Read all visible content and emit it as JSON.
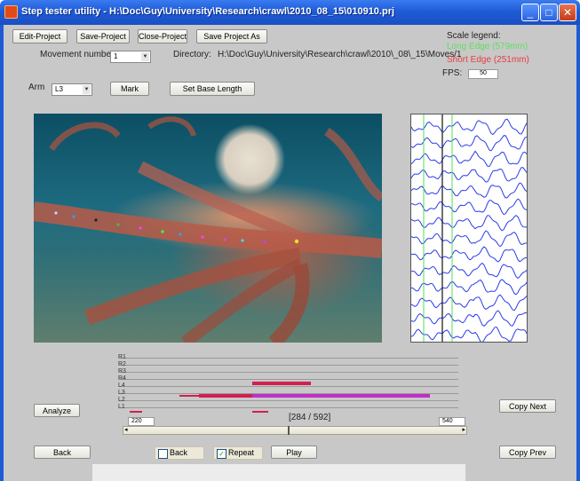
{
  "window": {
    "title": "Step tester utility - H:\\Doc\\Guy\\University\\Research\\crawl\\2010_08_15\\010910.prj",
    "controls": {
      "minimize": "_",
      "maximize": "□",
      "close": "✕"
    }
  },
  "toolbar": {
    "edit_project": "Edit-Project",
    "save_project": "Save-Project",
    "close_project": "Close-Project",
    "save_project_as": "Save Project As"
  },
  "movement": {
    "label": "Movement number",
    "value": "1"
  },
  "directory": {
    "label": "Directory:",
    "value": "H:\\Doc\\Guy\\University\\Research\\crawl\\2010\\_08\\_15\\Moves/1"
  },
  "scale_legend": {
    "title": "Scale legend:",
    "long_edge": "Long Edge (579mm)",
    "short_edge": "Short Edge (251mm)",
    "long_color": "#5ee05e",
    "short_color": "#e83c3c"
  },
  "fps": {
    "label": "FPS:",
    "value": "50"
  },
  "arm": {
    "label": "Arm",
    "value": "L3"
  },
  "buttons": {
    "mark": "Mark",
    "set_base_length": "Set Base Length",
    "analyze": "Analyze",
    "copy_next": "Copy Next",
    "copy_prev": "Copy Prev",
    "back": "Back",
    "play": "Play"
  },
  "checkboxes": {
    "back": {
      "label": "Back",
      "checked": false
    },
    "repeat": {
      "label": "Repeat",
      "checked": true
    }
  },
  "timeline": {
    "tracks": [
      "R1",
      "R2",
      "R3",
      "R4",
      "L4",
      "L3",
      "L2",
      "L1"
    ],
    "frame_start": "220",
    "frame_end": "540",
    "frame_counter": "[284 / 592]",
    "current_frame": 284,
    "total_frames": 592,
    "slider_position": 0.48
  }
}
